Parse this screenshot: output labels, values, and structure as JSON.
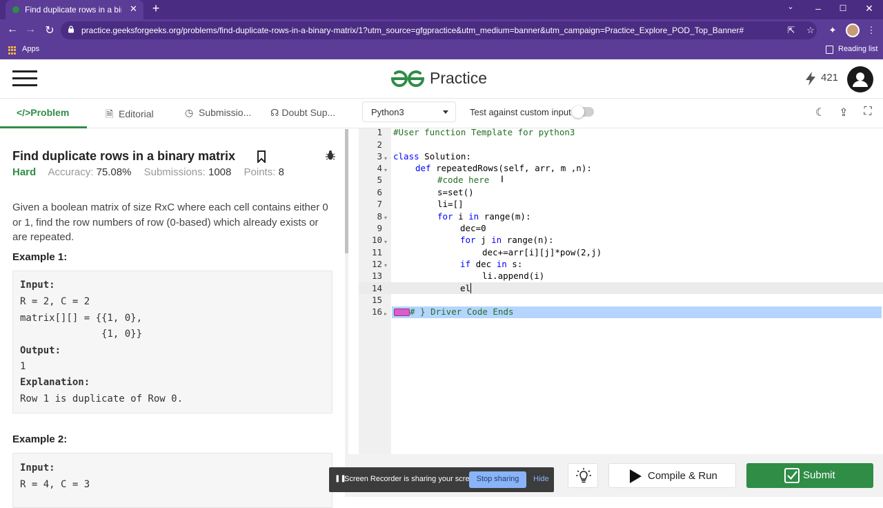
{
  "browser": {
    "tab_title": "Find duplicate rows in a binary m",
    "tab_close": "✕",
    "new_tab": "+",
    "url": "practice.geeksforgeeks.org/problems/find-duplicate-rows-in-a-binary-matrix/1?utm_source=gfgpractice&utm_medium=banner&utm_campaign=Practice_Explore_POD_Top_Banner#",
    "bookmarks_apps": "Apps",
    "reading_list": "Reading list"
  },
  "header": {
    "logo_text": "Practice",
    "streak": "421"
  },
  "tabs": [
    {
      "icon": "</>",
      "label": "Problem"
    },
    {
      "label": "Editorial"
    },
    {
      "label": "Submissio..."
    },
    {
      "label": "Doubt Sup..."
    }
  ],
  "editor_bar": {
    "language": "Python3",
    "custom_input_label": "Test against custom input"
  },
  "problem": {
    "title": "Find duplicate rows in a binary matrix",
    "difficulty": "Hard",
    "accuracy_label": "Accuracy:",
    "accuracy": "75.08%",
    "submissions_label": "Submissions:",
    "submissions": "1008",
    "points_label": "Points:",
    "points": "8",
    "description": "Given a boolean matrix of size RxC where each cell contains either 0 or 1, find the row numbers of row (0-based) which already exists or are repeated.",
    "example1_heading": "Example 1:",
    "example1": {
      "input_label": "Input:",
      "line1": "R = 2, C = 2",
      "line2": "matrix[][] = {{1, 0},",
      "line3": "              {1, 0}}",
      "output_label": "Output:",
      "output": "1",
      "explanation_label": "Explanation:",
      "explanation": "Row 1 is duplicate of Row 0."
    },
    "example2_heading": "Example 2:",
    "example2": {
      "input_label": "Input:",
      "line1": "R = 4, C = 3"
    }
  },
  "code": {
    "line_numbers": [
      "1",
      "2",
      "3",
      "4",
      "5",
      "6",
      "7",
      "8",
      "9",
      "10",
      "11",
      "12",
      "13",
      "14",
      "15",
      "16"
    ],
    "l1": "#User function Template for python3",
    "l3_kw": "class",
    "l3_rest": " Solution:",
    "l4_kw": "def",
    "l4_rest": " repeatedRows(self, arr, m ,n):",
    "l5": "#code here",
    "l6": "s=set()",
    "l7": "li=[]",
    "l8_kw1": "for",
    "l8_mid": " i ",
    "l8_kw2": "in",
    "l8_rest": " range(m):",
    "l9": "dec=0",
    "l10_kw1": "for",
    "l10_mid": " j ",
    "l10_kw2": "in",
    "l10_rest": " range(n):",
    "l11": "dec+=arr[i][j]*pow(2,j)",
    "l12_kw1": "if",
    "l12_mid": " dec ",
    "l12_kw2": "in",
    "l12_rest": " s:",
    "l13": "li.append(i)",
    "l14": "el",
    "l16": "# } Driver Code Ends"
  },
  "actions": {
    "compile_run": "Compile & Run",
    "submit": "Submit"
  },
  "recorder": {
    "message": "Screen Recorder is sharing your screen.",
    "stop": "Stop sharing",
    "hide": "Hide"
  }
}
